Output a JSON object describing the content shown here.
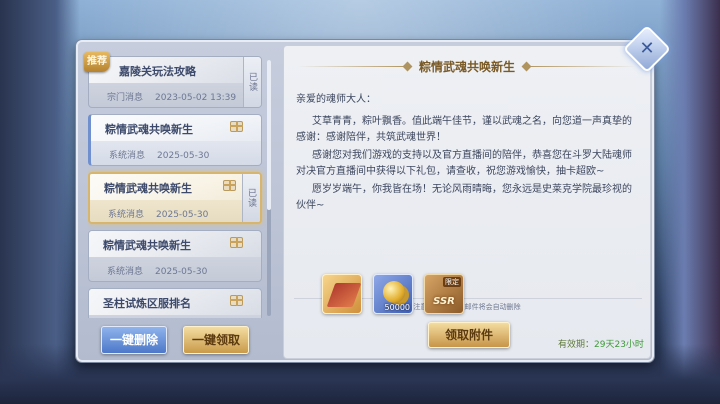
{
  "pin_label": "推荐",
  "mail_list": [
    {
      "title": "嘉陵关玩法攻略",
      "source": "宗门消息",
      "date": "2023-05-02 13:39",
      "read_label": "已读"
    },
    {
      "title": "粽情武魂共唤新生",
      "source": "系统消息",
      "date": "2025-05-30",
      "read_label": ""
    },
    {
      "title": "粽情武魂共唤新生",
      "source": "系统消息",
      "date": "2025-05-30",
      "read_label": "已读"
    },
    {
      "title": "粽情武魂共唤新生",
      "source": "系统消息",
      "date": "2025-05-30",
      "read_label": ""
    },
    {
      "title": "圣柱试炼区服排名",
      "source": "",
      "date": "",
      "read_label": ""
    }
  ],
  "buttons": {
    "delete_all": "一键删除",
    "claim_all": "一键领取",
    "claim_attachment": "领取附件"
  },
  "mail": {
    "title": "粽情武魂共唤新生",
    "greeting": "亲爱的魂师大人：",
    "paragraphs": [
      "艾草青青，粽叶飘香。值此端午佳节，谨以武魂之名，向您道一声真挚的感谢：感谢陪伴，共筑武魂世界！",
      "感谢您对我们游戏的支持以及官方直播间的陪伴，恭喜您在斗罗大陆魂师对决官方直播间中获得以下礼包，请查收，祝您游戏愉快，抽卡超欧~",
      "愿岁岁端午，你我皆在场！无论风雨晴晦，您永远是史莱克学院最珍视的伙伴~"
    ],
    "notice": "注意:有效期结束邮件将会自动删除",
    "attachments": [
      {
        "name": "ribbon-item",
        "count": ""
      },
      {
        "name": "gold-coins",
        "count": "50000"
      },
      {
        "name": "ssr-card",
        "count": "",
        "badge": "限定",
        "label": "SSR"
      }
    ],
    "validity_label": "有效期：",
    "validity_value": "29天23小时"
  }
}
